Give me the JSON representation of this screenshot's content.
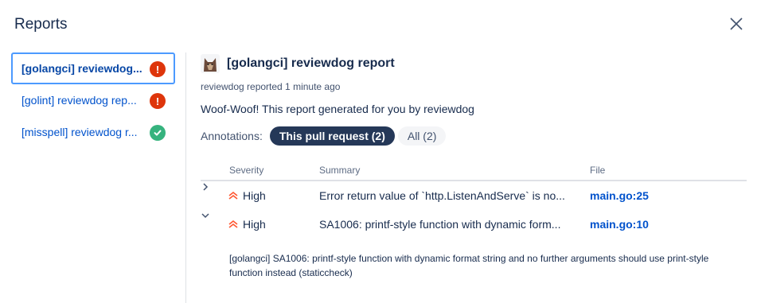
{
  "dialog": {
    "title": "Reports"
  },
  "sidebar": {
    "items": [
      {
        "label": "[golangci] reviewdog...",
        "status": "error",
        "active": true
      },
      {
        "label": "[golint] reviewdog rep...",
        "status": "error",
        "active": false
      },
      {
        "label": "[misspell] reviewdog r...",
        "status": "success",
        "active": false
      }
    ]
  },
  "report": {
    "title": "[golangci] reviewdog report",
    "reporter": "reviewdog reported 1 minute ago",
    "description": "Woof-Woof! This report generated for you by reviewdog",
    "annotations_label": "Annotations:",
    "filters": {
      "this_pr": "This pull request (2)",
      "all": "All (2)"
    }
  },
  "table": {
    "headers": {
      "severity": "Severity",
      "summary": "Summary",
      "file": "File"
    },
    "rows": [
      {
        "expanded": false,
        "severity": "High",
        "summary": "Error return value of `http.ListenAndServe` is no...",
        "file": "main.go:25"
      },
      {
        "expanded": true,
        "severity": "High",
        "summary": "SA1006: printf-style function with dynamic form...",
        "file": "main.go:10",
        "detail": "[golangci] SA1006: printf-style function with dynamic format string and no further arguments should use print-style function instead (staticcheck)"
      }
    ]
  },
  "colors": {
    "error": "#de350b",
    "success": "#36b37e",
    "link": "#0052cc",
    "selected_pill": "#253858",
    "severity_high": "#ff5630"
  },
  "icons": {
    "close": "close-icon",
    "error": "exclamation-icon",
    "success": "checkmark-icon",
    "severity": "double-chevron-up-icon"
  }
}
